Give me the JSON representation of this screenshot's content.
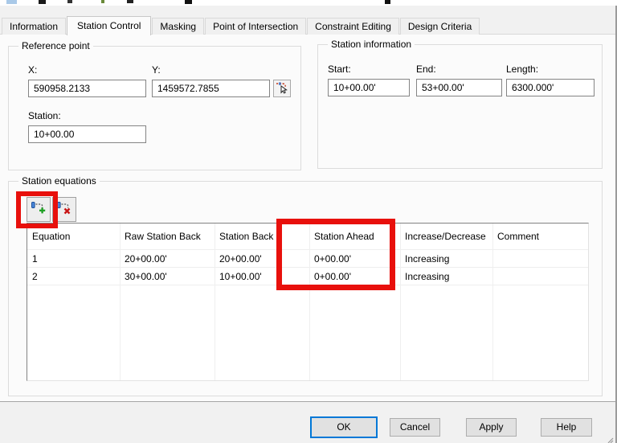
{
  "tabs": {
    "items": [
      "Information",
      "Station Control",
      "Masking",
      "Point of Intersection",
      "Constraint Editing",
      "Design Criteria"
    ],
    "active": "Station Control"
  },
  "reference_point": {
    "title": "Reference point",
    "x_label": "X:",
    "x_value": "590958.2133",
    "y_label": "Y:",
    "y_value": "1459572.7855",
    "station_label": "Station:",
    "station_value": "10+00.00"
  },
  "station_information": {
    "title": "Station information",
    "start_label": "Start:",
    "start_value": "10+00.00'",
    "end_label": "End:",
    "end_value": "53+00.00'",
    "length_label": "Length:",
    "length_value": "6300.000'"
  },
  "station_equations": {
    "title": "Station equations",
    "columns": [
      "Equation",
      "Raw Station Back",
      "Station Back",
      "Station Ahead",
      "Increase/Decrease",
      "Comment"
    ],
    "rows": [
      [
        "1",
        "20+00.00'",
        "20+00.00'",
        "0+00.00'",
        "Increasing",
        ""
      ],
      [
        "2",
        "30+00.00'",
        "10+00.00'",
        "0+00.00'",
        "Increasing",
        ""
      ]
    ],
    "toolbar": {
      "add_icon": "add-station-equation-icon",
      "delete_icon": "delete-station-equation-icon"
    }
  },
  "buttons": {
    "ok": "OK",
    "cancel": "Cancel",
    "apply": "Apply",
    "help": "Help"
  },
  "icons": {
    "pick_icon": "pick-point-on-screen-icon"
  },
  "colors": {
    "annotation_highlight": "#e8100c",
    "ok_focus_border": "#0078d7"
  }
}
